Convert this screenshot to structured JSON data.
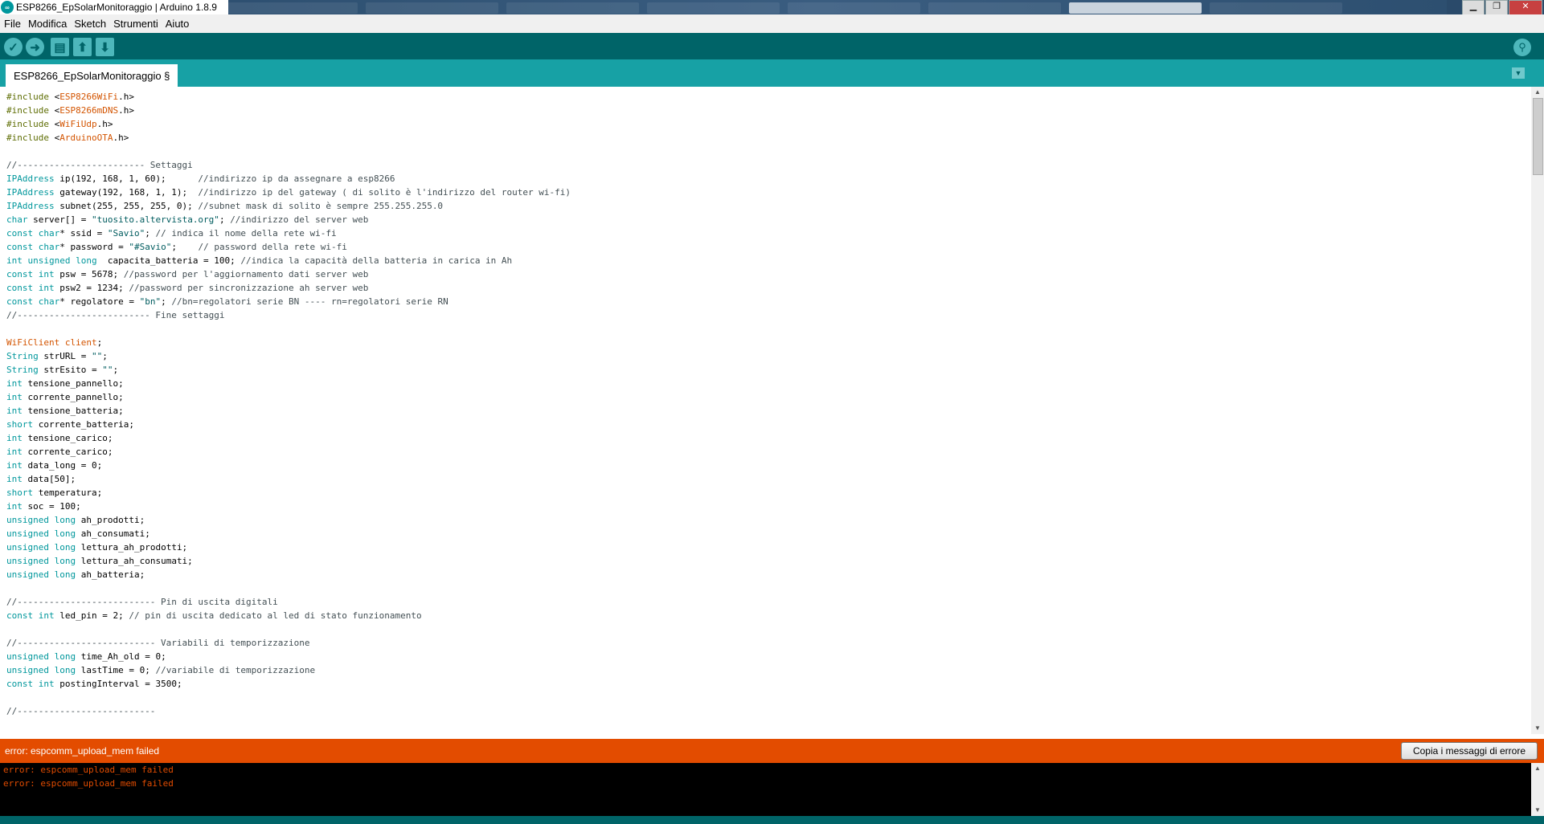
{
  "window": {
    "title": "ESP8266_EpSolarMonitoraggio | Arduino 1.8.9",
    "icon": "arduino-logo-icon",
    "controls": [
      "minimize-icon",
      "maximize-icon",
      "close-icon"
    ]
  },
  "menu": [
    "File",
    "Modifica",
    "Sketch",
    "Strumenti",
    "Aiuto"
  ],
  "toolbar": {
    "buttons": [
      {
        "name": "verify-button",
        "icon": "checkmark-icon",
        "glyph": "✓"
      },
      {
        "name": "upload-button",
        "icon": "arrow-right-icon",
        "glyph": "➜"
      },
      {
        "name": "new-button",
        "icon": "new-file-icon",
        "glyph": "▤"
      },
      {
        "name": "open-button",
        "icon": "arrow-up-icon",
        "glyph": "⬆"
      },
      {
        "name": "save-button",
        "icon": "arrow-down-icon",
        "glyph": "⬇"
      }
    ],
    "serial_monitor_icon": "magnifier-icon",
    "serial_glyph": "⚲"
  },
  "tab": {
    "label": "ESP8266_EpSolarMonitoraggio §",
    "menu_glyph": "▼"
  },
  "code_lines": [
    "#include <ESP8266WiFi.h>",
    "#include <ESP8266mDNS.h>",
    "#include <WiFiUdp.h>",
    "#include <ArduinoOTA.h>",
    "",
    "//------------------------ Settaggi",
    "IPAddress ip(192, 168, 1, 60);      //indirizzo ip da assegnare a esp8266",
    "IPAddress gateway(192, 168, 1, 1);  //indirizzo ip del gateway ( di solito è l'indirizzo del router wi-fi)",
    "IPAddress subnet(255, 255, 255, 0); //subnet mask di solito è sempre 255.255.255.0",
    "char server[] = \"tuosito.altervista.org\"; //indirizzo del server web",
    "const char* ssid = \"Savio\"; // indica il nome della rete wi-fi",
    "const char* password = \"#Savio\";    // password della rete wi-fi",
    "int unsigned long  capacita_batteria = 100; //indica la capacità della batteria in carica in Ah",
    "const int psw = 5678; //password per l'aggiornamento dati server web",
    "const int psw2 = 1234; //password per sincronizzazione ah server web",
    "const char* regolatore = \"bn\"; //bn=regolatori serie BN ---- rn=regolatori serie RN",
    "//------------------------- Fine settaggi",
    "",
    "WiFiClient client;",
    "String strURL = \"\";",
    "String strEsito = \"\";",
    "int tensione_pannello;",
    "int corrente_pannello;",
    "int tensione_batteria;",
    "short corrente_batteria;",
    "int tensione_carico;",
    "int corrente_carico;",
    "int data_long = 0;",
    "int data[50];",
    "short temperatura;",
    "int soc = 100;",
    "unsigned long ah_prodotti;",
    "unsigned long ah_consumati;",
    "unsigned long lettura_ah_prodotti;",
    "unsigned long lettura_ah_consumati;",
    "unsigned long ah_batteria;",
    "",
    "//-------------------------- Pin di uscita digitali",
    "const int led_pin = 2; // pin di uscita dedicato al led di stato funzionamento",
    "",
    "//-------------------------- Variabili di temporizzazione",
    "unsigned long time_Ah_old = 0;",
    "unsigned long lastTime = 0; //variabile di temporizzazione",
    "const int postingInterval = 3500;",
    "",
    "//--------------------------"
  ],
  "status": {
    "message": "error: espcomm_upload_mem failed",
    "copy_button": "Copia i messaggi di errore"
  },
  "console": [
    "error: espcomm_upload_mem failed",
    "error: espcomm_upload_mem failed"
  ],
  "colors": {
    "toolbar": "#006468",
    "tabbar": "#17a1a5",
    "error_bar": "#e34c00",
    "console_text": "#e34c00",
    "keyword": "#00979c",
    "library": "#d35400"
  }
}
